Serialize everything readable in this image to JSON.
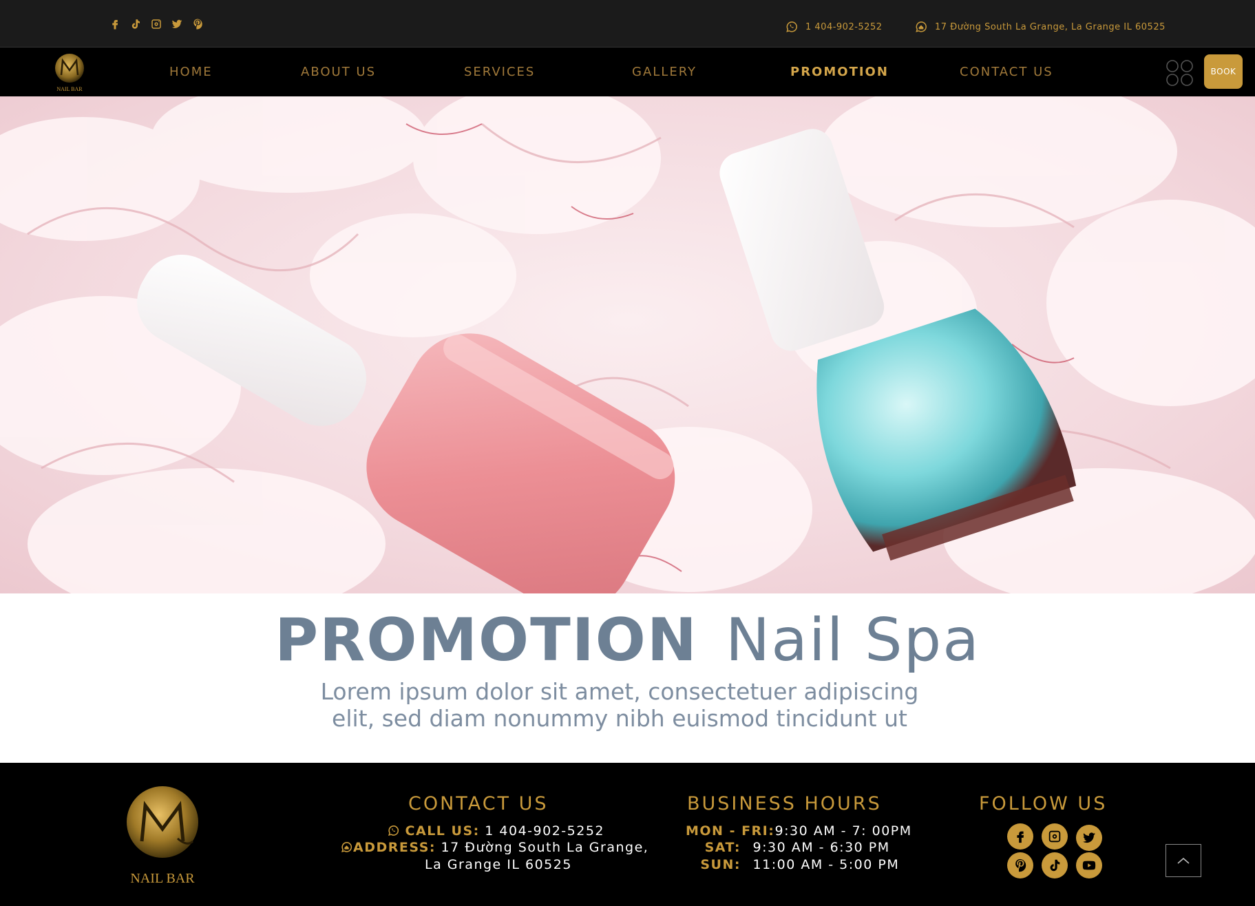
{
  "topbar": {
    "social_icons": [
      "facebook-icon",
      "tiktok-icon",
      "instagram-icon",
      "twitter-icon",
      "pinterest-icon"
    ],
    "phone": "1 404-902-5252",
    "address": "17 Đường South La Grange, La Grange IL 60525"
  },
  "nav": {
    "logo_text": "NAIL BAR",
    "items": [
      {
        "label": "HOME",
        "active": false
      },
      {
        "label": "ABOUT US",
        "active": false
      },
      {
        "label": "SERVICES",
        "active": false
      },
      {
        "label": "GALLERY",
        "active": false
      },
      {
        "label": "PROMOTION",
        "active": true
      },
      {
        "label": "CONTACT US",
        "active": false
      }
    ],
    "book_label": "BOOK"
  },
  "promo": {
    "title_bold": "PROMOTION",
    "title_light": "Nail Spa",
    "subtitle_line1": "Lorem ipsum dolor sit amet, consectetuer adipiscing",
    "subtitle_line2": "elit, sed diam nonummy nibh euismod tincidunt ut"
  },
  "footer": {
    "logo_text": "NAIL BAR",
    "contact": {
      "heading": "CONTACT US",
      "call_label": "CALL US:",
      "call_value": "1 404-902-5252",
      "address_label": "ADDRESS:",
      "address_line1": "17 Đường South La Grange,",
      "address_line2": "La Grange IL 60525"
    },
    "hours": {
      "heading": "BUSINESS HOURS",
      "rows": [
        {
          "day": "MON - FRI:",
          "time": "9:30 AM - 7: 00PM"
        },
        {
          "day": "SAT:",
          "time": "9:30 AM - 6:30 PM"
        },
        {
          "day": "SUN:",
          "time": "11:00 AM - 5:00 PM"
        }
      ]
    },
    "follow": {
      "heading": "FOLLOW US",
      "icons": [
        "facebook-icon",
        "instagram-icon",
        "twitter-icon",
        "pinterest-icon",
        "tiktok-icon",
        "youtube-icon"
      ]
    }
  },
  "colors": {
    "gold": "#c99a3b",
    "dark": "#1b1b1b",
    "black": "#000000",
    "slate_text": "#6d8094"
  }
}
